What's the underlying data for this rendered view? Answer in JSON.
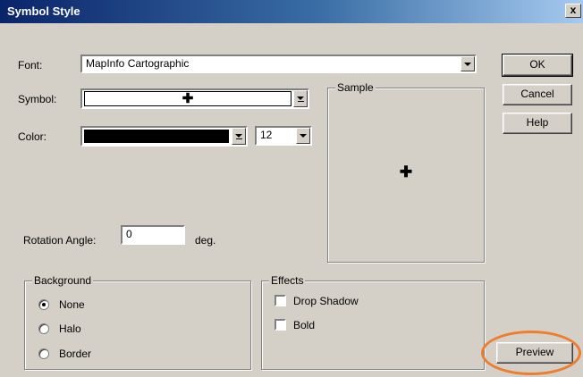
{
  "window": {
    "title": "Symbol Style",
    "close_label": "x"
  },
  "font_row": {
    "label": "Font:",
    "value": "MapInfo Cartographic"
  },
  "symbol_row": {
    "label": "Symbol:",
    "glyph": "✚"
  },
  "color_row": {
    "label": "Color:",
    "color": "#000000",
    "size": "12"
  },
  "sample": {
    "title": "Sample",
    "glyph": "✚"
  },
  "rotation": {
    "label": "Rotation Angle:",
    "value": "0",
    "unit": "deg."
  },
  "background_group": {
    "title": "Background",
    "options": [
      {
        "label": "None",
        "checked": true
      },
      {
        "label": "Halo",
        "checked": false
      },
      {
        "label": "Border",
        "checked": false
      }
    ]
  },
  "effects_group": {
    "title": "Effects",
    "options": [
      {
        "label": "Drop Shadow",
        "checked": false
      },
      {
        "label": "Bold",
        "checked": false
      }
    ]
  },
  "buttons": {
    "ok": "OK",
    "cancel": "Cancel",
    "help": "Help",
    "preview": "Preview"
  },
  "colors": {
    "highlight_ring": "#ee7d2e",
    "titlebar": "#0a246a"
  }
}
